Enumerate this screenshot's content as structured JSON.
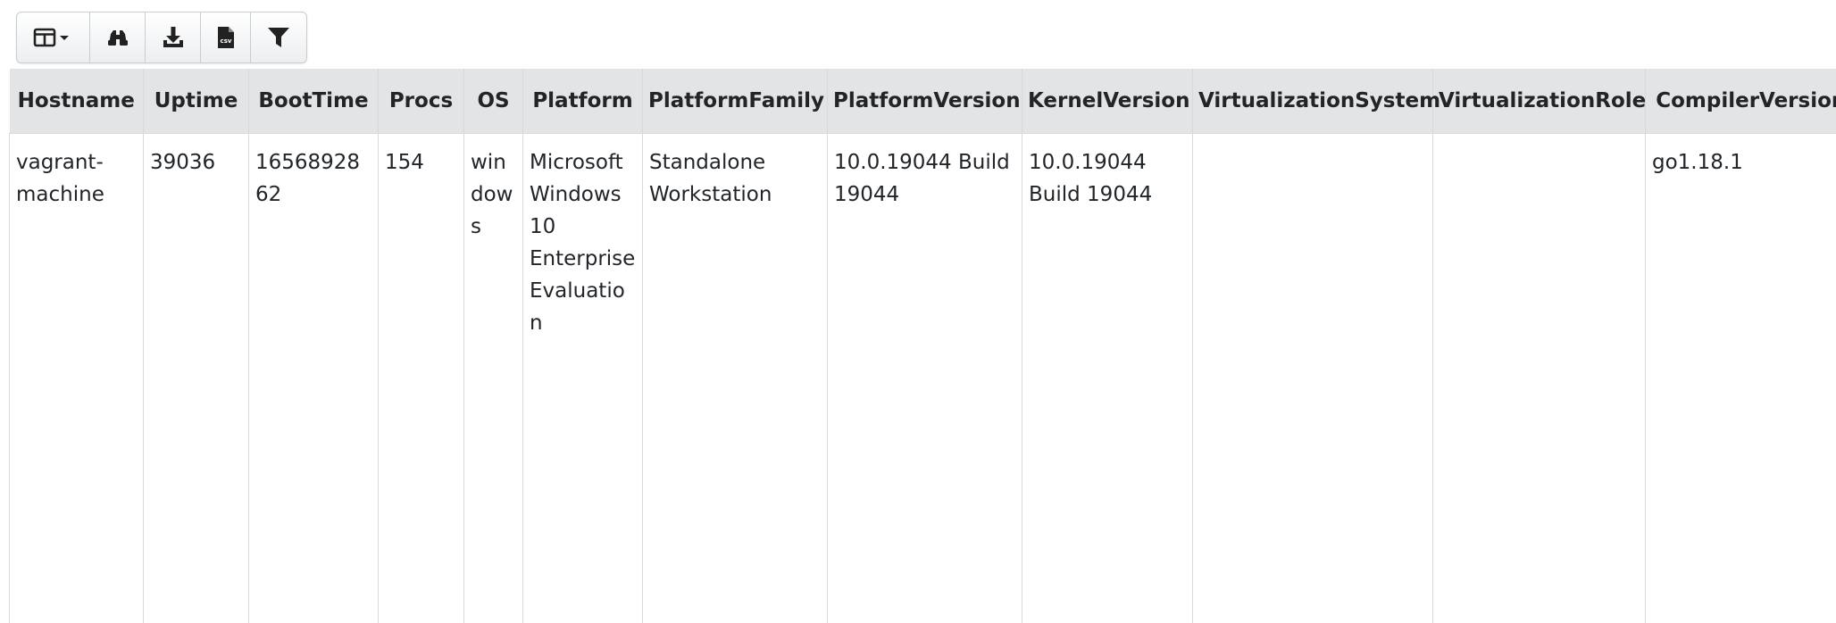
{
  "toolbar": {
    "buttons": [
      {
        "icon": "columns-icon",
        "has_dropdown": true
      },
      {
        "icon": "binoculars-icon"
      },
      {
        "icon": "download-icon"
      },
      {
        "icon": "csv-file-icon",
        "icon_text": "csv"
      },
      {
        "icon": "filter-icon"
      }
    ]
  },
  "table": {
    "columns": [
      "Hostname",
      "Uptime",
      "BootTime",
      "Procs",
      "OS",
      "Platform",
      "PlatformFamily",
      "PlatformVersion",
      "KernelVersion",
      "VirtualizationSystem",
      "VirtualizationRole",
      "CompilerVersion"
    ],
    "rows": [
      {
        "hostname": "vagrant-machine",
        "uptime": "39036",
        "boottime": "1656892862",
        "procs": "154",
        "os": "windows",
        "platform": "Microsoft Windows 10 Enterprise Evaluation",
        "platform_family": "Standalone Workstation",
        "platform_version": "10.0.19044 Build 19044",
        "kernel_version": "10.0.19044 Build 19044",
        "virtualization_system": "",
        "virtualization_role": "",
        "compiler_version": "go1.18.1"
      }
    ]
  },
  "colors": {
    "header_bg": "#e3e4e5",
    "border": "#d7d9dc",
    "text": "#212529"
  }
}
